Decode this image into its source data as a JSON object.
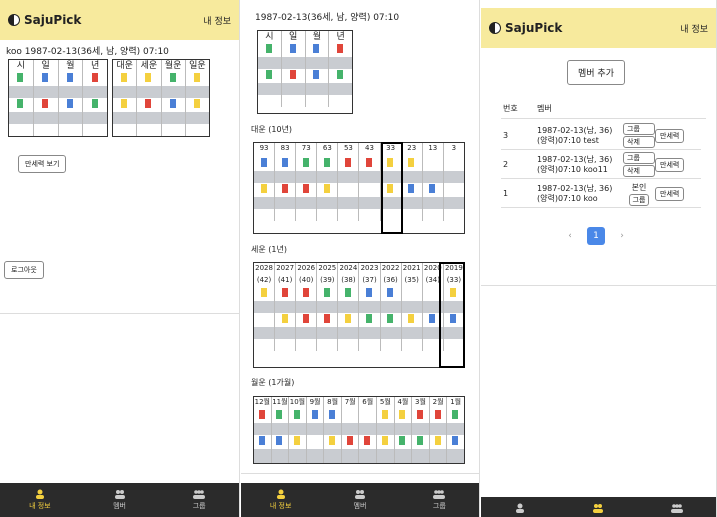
{
  "app": {
    "name": "SajuPick",
    "myinfo": "내 정보"
  },
  "panel1": {
    "user_line": "koo 1987-02-13(36세, 남, 양력) 07:10",
    "saju_headers": [
      "시",
      "일",
      "월",
      "년"
    ],
    "daeun_headers": [
      "대운",
      "세운",
      "월운",
      "일운"
    ],
    "man_button": "만세력 보기",
    "logout_button": "로그아웃"
  },
  "panel2": {
    "title_line": "1987-02-13(36세, 남, 양력) 07:10",
    "headers": [
      "시",
      "일",
      "월",
      "년"
    ],
    "daeun_title": "대운 (10년)",
    "daeun_ages": [
      "93",
      "83",
      "73",
      "63",
      "53",
      "43",
      "33",
      "23",
      "13",
      "3"
    ],
    "seun_title": "세운 (1년)",
    "seun_years": [
      "2028",
      "2027",
      "2026",
      "2025",
      "2024",
      "2023",
      "2022",
      "2021",
      "2020",
      "2019"
    ],
    "seun_ages": [
      "(42)",
      "(41)",
      "(40)",
      "(39)",
      "(38)",
      "(37)",
      "(36)",
      "(35)",
      "(34)",
      "(33)"
    ],
    "wolun_title": "월운 (1가월)",
    "months": [
      "12월",
      "11월",
      "10월",
      "9월",
      "8월",
      "7월",
      "6월",
      "5월",
      "4월",
      "3월",
      "2월",
      "1월"
    ]
  },
  "panel3": {
    "add_button": "멤버 추가",
    "col_num": "번호",
    "col_member": "멤버",
    "members": [
      {
        "num": "3",
        "line1": "1987-02-13(남, 36)",
        "line2": "(양력)07:10 test",
        "btn1": "그룹",
        "btn2": "삭제",
        "btn3": "만세력"
      },
      {
        "num": "2",
        "line1": "1987-02-13(남, 36)",
        "line2": "(양력)07:10 koo11",
        "btn1": "그룹",
        "btn2": "삭제",
        "btn3": "만세력"
      },
      {
        "num": "1",
        "line1": "1987-02-13(남, 36)",
        "line2": "(양력)07:10 koo",
        "btn1": "본인",
        "btn2": "그룹",
        "btn3": "만세력"
      }
    ],
    "page": "1"
  },
  "nav": {
    "myinfo": "내 정보",
    "member": "멤버",
    "group": "그룹"
  },
  "colors": {
    "header": "#f7ea9d",
    "accent": "#f4d03f",
    "nav_bg": "#2b2b2b",
    "page_active": "#4a88e8"
  }
}
